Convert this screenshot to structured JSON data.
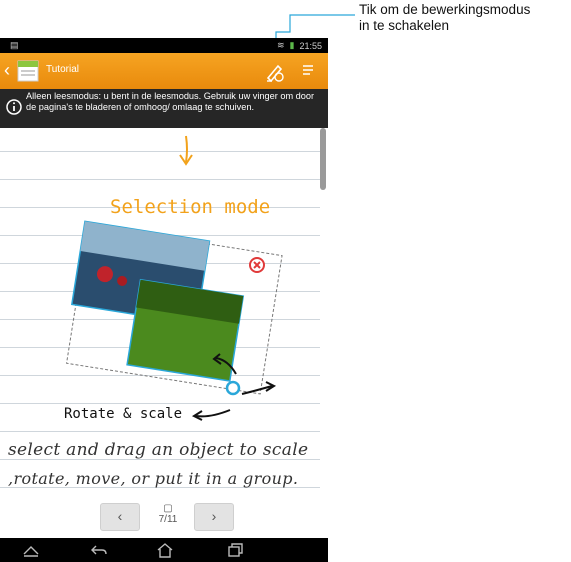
{
  "callout": {
    "line1": "Tik om de bewerkingsmodus",
    "line2": "in te schakelen"
  },
  "statusbar": {
    "time": "21:55"
  },
  "appbar": {
    "title": "Tutorial"
  },
  "banner": {
    "text": "Alleen leesmodus: u bent in de leesmodus. Gebruik uw vinger om door de pagina's te bladeren of omhoog/ omlaag te schuiven."
  },
  "note": {
    "heading": "Selection mode",
    "caption": "Rotate & scale",
    "handwriting_line1": "select and drag an object to scale",
    "handwriting_line2": ",rotate, move, or put it in a group."
  },
  "pager": {
    "current": 7,
    "total": 11,
    "label": "7/11",
    "prev": "‹",
    "next": "›"
  },
  "colors": {
    "appbar": "#f19a18",
    "accent_blue": "#2aa7d9",
    "heading_orange": "#f2a21b",
    "delete_red": "#e03a3a"
  },
  "icons": [
    "back-chevron-icon",
    "notes-app-icon",
    "edit-mode-icon",
    "menu-icon",
    "info-icon",
    "delete-icon",
    "page-icon",
    "collapse-icon",
    "back-icon",
    "home-icon",
    "recent-apps-icon"
  ]
}
